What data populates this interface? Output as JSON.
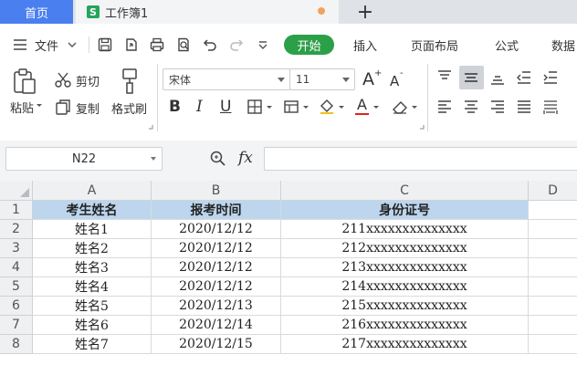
{
  "tabs": {
    "home": "首页",
    "doc_icon": "S",
    "doc_title": "工作簿1",
    "new_tab": "+"
  },
  "menu": {
    "file": "文件",
    "start": "开始",
    "items": [
      "插入",
      "页面布局",
      "公式",
      "数据"
    ]
  },
  "ribbon": {
    "paste": "粘贴",
    "cut": "剪切",
    "copy": "复制",
    "format_painter": "格式刷",
    "font_name": "宋体",
    "font_size": "11",
    "bold": "B",
    "italic": "I",
    "underline": "U",
    "grow_font": "A",
    "shrink_font": "A",
    "font_color_letter": "A",
    "font_color": "#e02020"
  },
  "formula_bar": {
    "name_box": "N22",
    "fx": "fx",
    "formula": ""
  },
  "sheet": {
    "columns": [
      "A",
      "B",
      "C",
      "D"
    ],
    "rows": [
      "1",
      "2",
      "3",
      "4",
      "5",
      "6",
      "7",
      "8"
    ],
    "header_fill": "#bdd6ee",
    "headers": [
      "考生姓名",
      "报考时间",
      "身份证号"
    ],
    "data": [
      [
        "姓名1",
        "2020/12/12",
        "211xxxxxxxxxxxxxx"
      ],
      [
        "姓名2",
        "2020/12/12",
        "212xxxxxxxxxxxxxx"
      ],
      [
        "姓名3",
        "2020/12/12",
        "213xxxxxxxxxxxxxx"
      ],
      [
        "姓名4",
        "2020/12/12",
        "214xxxxxxxxxxxxxx"
      ],
      [
        "姓名5",
        "2020/12/13",
        "215xxxxxxxxxxxxxx"
      ],
      [
        "姓名6",
        "2020/12/14",
        "216xxxxxxxxxxxxxx"
      ],
      [
        "姓名7",
        "2020/12/15",
        "217xxxxxxxxxxxxxx"
      ]
    ]
  },
  "colors": {
    "accent_blue": "#4a7ff0",
    "start_green": "#2c9f49"
  }
}
